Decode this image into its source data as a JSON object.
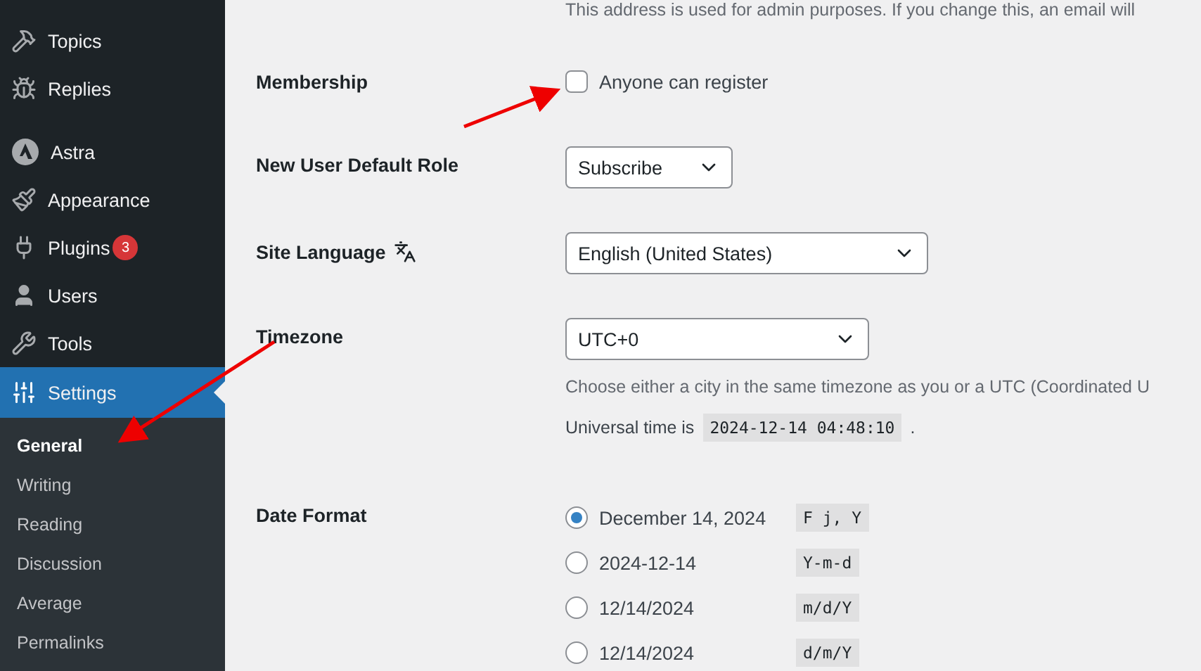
{
  "sidebar": {
    "groups": [
      [
        {
          "label": "Topics",
          "selected": false
        },
        {
          "label": "Replies",
          "selected": false
        }
      ],
      [
        {
          "label": "Astra",
          "selected": false
        },
        {
          "label": "Appearance",
          "selected": false
        },
        {
          "label": "Plugins",
          "selected": false,
          "badge": "3"
        },
        {
          "label": "Users",
          "selected": false
        },
        {
          "label": "Tools",
          "selected": false
        },
        {
          "label": "Settings",
          "selected": true
        }
      ]
    ],
    "submenu": [
      {
        "label": "General",
        "selected": true
      },
      {
        "label": "Writing",
        "selected": false
      },
      {
        "label": "Reading",
        "selected": false
      },
      {
        "label": "Discussion",
        "selected": false
      },
      {
        "label": "Average",
        "selected": false
      },
      {
        "label": "Permalinks",
        "selected": false
      }
    ]
  },
  "top_note": "This address is used for admin purposes. If you change this, an email will",
  "membership": {
    "label": "Membership",
    "checkbox_label": "Anyone can register",
    "checked": false
  },
  "default_role": {
    "label": "New User Default Role",
    "value": "Subscribe"
  },
  "site_language": {
    "label": "Site Language",
    "value": "English (United States)"
  },
  "timezone": {
    "label": "Timezone",
    "value": "UTC+0",
    "description": "Choose either a city in the same timezone as you or a UTC (Coordinated U",
    "universal_prefix": "Universal time is",
    "universal_time": "2024-12-14 04:48:10",
    "universal_suffix": "."
  },
  "date_format": {
    "label": "Date Format",
    "options": [
      {
        "label": "December 14, 2024",
        "code": "F j, Y",
        "selected": true
      },
      {
        "label": "2024-12-14",
        "code": "Y-m-d",
        "selected": false
      },
      {
        "label": "12/14/2024",
        "code": "m/d/Y",
        "selected": false
      },
      {
        "label": "12/14/2024",
        "code": "d/m/Y",
        "selected": false
      }
    ]
  }
}
